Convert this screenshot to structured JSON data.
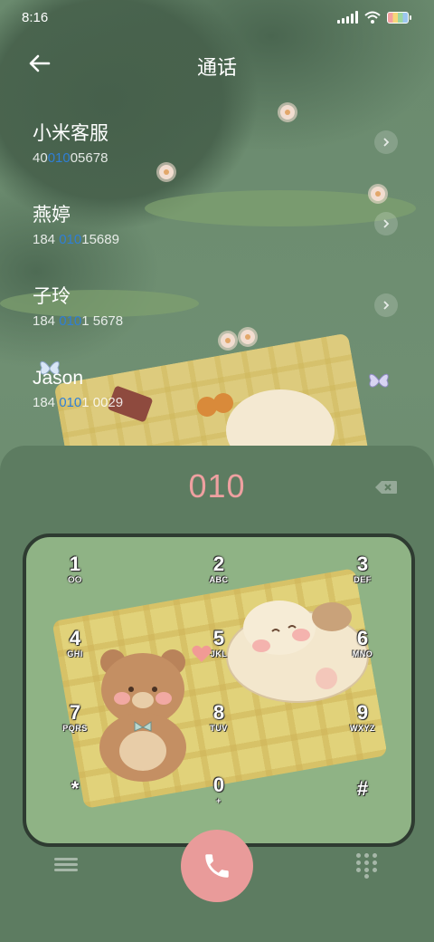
{
  "status_bar": {
    "time": "8:16"
  },
  "header": {
    "title": "通话"
  },
  "contacts": [
    {
      "name": "小米客服",
      "number_pre": "40",
      "number_hl": "010",
      "number_post": "05678"
    },
    {
      "name": "燕婷",
      "number_pre": "184 ",
      "number_hl": "010",
      "number_post": "15689"
    },
    {
      "name": "子玲",
      "number_pre": "184 ",
      "number_hl": "010",
      "number_post": "1 5678"
    },
    {
      "name": "Jason",
      "number_pre": "184 ",
      "number_hl": "010",
      "number_post": "1 0029"
    }
  ],
  "dialer": {
    "input_value": "010",
    "keys": [
      {
        "digit": "1",
        "letters": "voicemail"
      },
      {
        "digit": "2",
        "letters": "ABC"
      },
      {
        "digit": "3",
        "letters": "DEF"
      },
      {
        "digit": "4",
        "letters": "GHI"
      },
      {
        "digit": "5",
        "letters": "JKL"
      },
      {
        "digit": "6",
        "letters": "MNO"
      },
      {
        "digit": "7",
        "letters": "PQRS"
      },
      {
        "digit": "8",
        "letters": "TUV"
      },
      {
        "digit": "9",
        "letters": "WXYZ"
      },
      {
        "digit": "*",
        "letters": ""
      },
      {
        "digit": "0",
        "letters": "+"
      },
      {
        "digit": "#",
        "letters": ""
      }
    ]
  },
  "colors": {
    "accent_pink": "#eea0a0",
    "highlight_blue": "#2f7fd6",
    "call_button": "#e99b9a"
  },
  "icons": {
    "back": "arrow-left-icon",
    "chevron": "chevron-right-icon",
    "delete": "backspace-icon",
    "menu": "menu-icon",
    "call": "phone-icon",
    "keypad": "dialpad-icon"
  }
}
